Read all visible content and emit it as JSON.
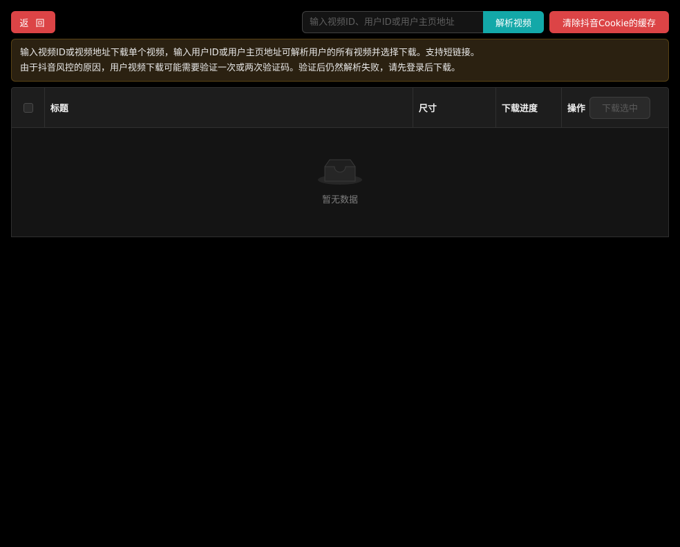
{
  "toolbar": {
    "back_label": "返 回",
    "search_placeholder": "输入视频ID、用户ID或用户主页地址",
    "search_value": "",
    "parse_label": "解析视频",
    "clear_cookie_label": "清除抖音Cookie的缓存"
  },
  "notice": {
    "line1": "输入视频ID或视频地址下载单个视频，输入用户ID或用户主页地址可解析用户的所有视频并选择下载。支持短链接。",
    "line2": "由于抖音风控的原因，用户视频下载可能需要验证一次或两次验证码。验证后仍然解析失败，请先登录后下载。"
  },
  "table": {
    "columns": {
      "title": "标题",
      "size": "尺寸",
      "progress": "下载进度",
      "action": "操作"
    },
    "download_selected_label": "下载选中",
    "rows": [],
    "empty_text": "暂无数据"
  },
  "colors": {
    "danger": "#dc4446",
    "primary": "#13a8a8",
    "notice_bg": "#2b2111",
    "notice_border": "#594214"
  },
  "icons": {
    "empty": "empty-inbox-icon"
  }
}
